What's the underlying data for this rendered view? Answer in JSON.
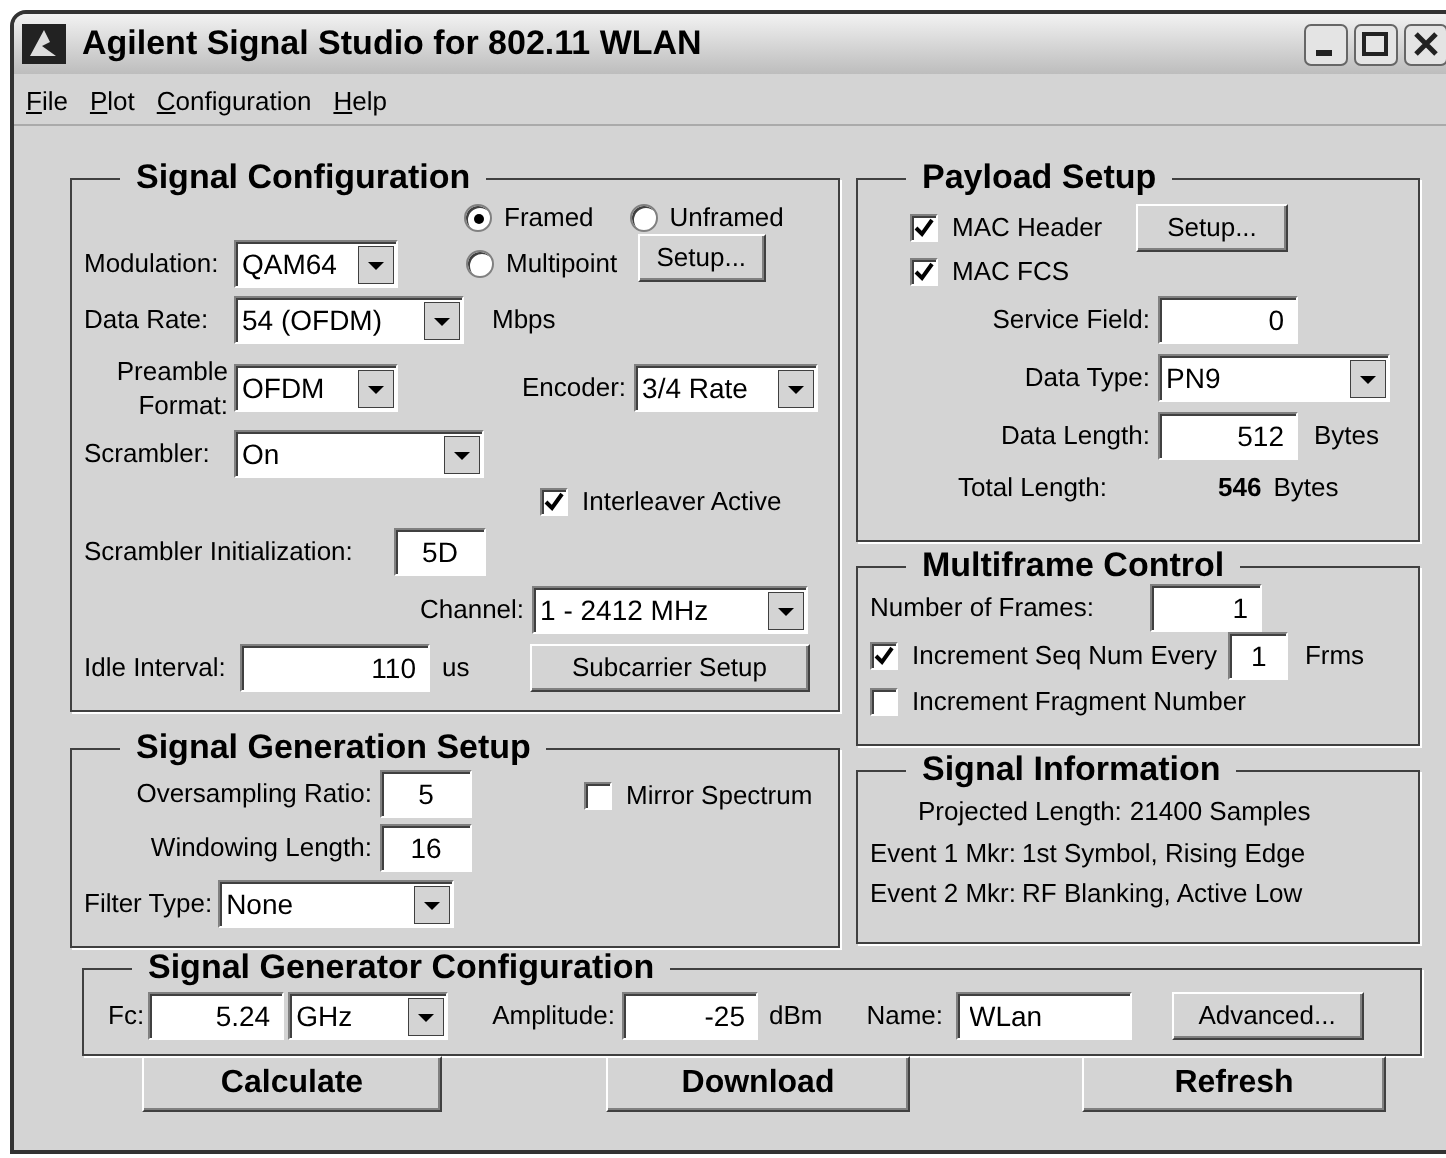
{
  "window": {
    "title": "Agilent Signal Studio for 802.11 WLAN"
  },
  "menu": [
    {
      "label": "File"
    },
    {
      "label": "Plot"
    },
    {
      "label": "Configuration"
    },
    {
      "label": "Help"
    }
  ],
  "signal_configuration": {
    "title": "Signal Configuration",
    "framing": [
      {
        "label": "Framed",
        "selected": true
      },
      {
        "label": "Unframed",
        "selected": false
      },
      {
        "label": "Multipoint",
        "selected": false
      }
    ],
    "setup_button": "Setup...",
    "modulation": {
      "label": "Modulation:",
      "value": "QAM64"
    },
    "data_rate": {
      "label": "Data Rate:",
      "value": "54 (OFDM)",
      "unit": "Mbps"
    },
    "preamble_format": {
      "label": "Preamble Format:",
      "value": "OFDM"
    },
    "encoder": {
      "label": "Encoder:",
      "value": "3/4 Rate"
    },
    "scrambler": {
      "label": "Scrambler:",
      "value": "On"
    },
    "interleaver": {
      "label": "Interleaver Active",
      "checked": true
    },
    "scrambler_initialization": {
      "label": "Scrambler Initialization:",
      "value": "5D"
    },
    "channel": {
      "label": "Channel:",
      "value": "1 - 2412 MHz"
    },
    "idle_interval": {
      "label": "Idle Interval:",
      "value": "110",
      "unit": "us"
    },
    "subcarrier_button": "Subcarrier Setup"
  },
  "signal_generation_setup": {
    "title": "Signal Generation Setup",
    "oversampling_ratio": {
      "label": "Oversampling Ratio:",
      "value": "5"
    },
    "mirror_spectrum": {
      "label": "Mirror Spectrum",
      "checked": false
    },
    "windowing_length": {
      "label": "Windowing Length:",
      "value": "16"
    },
    "filter_type": {
      "label": "Filter Type:",
      "value": "None"
    }
  },
  "payload_setup": {
    "title": "Payload Setup",
    "mac_header": {
      "label": "MAC Header",
      "checked": true
    },
    "setup_button": "Setup...",
    "mac_fcs": {
      "label": "MAC FCS",
      "checked": true
    },
    "service_field": {
      "label": "Service Field:",
      "value": "0"
    },
    "data_type": {
      "label": "Data Type:",
      "value": "PN9"
    },
    "data_length": {
      "label": "Data Length:",
      "value": "512",
      "unit": "Bytes"
    },
    "total_length": {
      "label": "Total Length:",
      "value": "546",
      "unit": "Bytes"
    }
  },
  "multiframe_control": {
    "title": "Multiframe Control",
    "number_of_frames": {
      "label": "Number of Frames:",
      "value": "1"
    },
    "increment_seq_num": {
      "label": "Increment Seq Num Every",
      "checked": true,
      "value": "1",
      "unit": "Frms"
    },
    "increment_fragment_number": {
      "label": "Increment Fragment Number",
      "checked": false
    }
  },
  "signal_information": {
    "title": "Signal Information",
    "projected_length": {
      "label": "Projected Length:",
      "value": "21400 Samples"
    },
    "event_markers": [
      {
        "label": "Event 1 Mkr:",
        "value": "1st Symbol, Rising Edge"
      },
      {
        "label": "Event 2 Mkr:",
        "value": "RF Blanking, Active Low"
      }
    ]
  },
  "signal_generator_configuration": {
    "title": "Signal Generator Configuration",
    "fc": {
      "label": "Fc:",
      "value": "5.24",
      "unit": "GHz"
    },
    "amplitude": {
      "label": "Amplitude:",
      "value": "-25",
      "unit": "dBm"
    },
    "name": {
      "label": "Name:",
      "value": "WLan"
    },
    "advanced_button": "Advanced..."
  },
  "buttons": [
    "Calculate",
    "Download",
    "Refresh"
  ]
}
